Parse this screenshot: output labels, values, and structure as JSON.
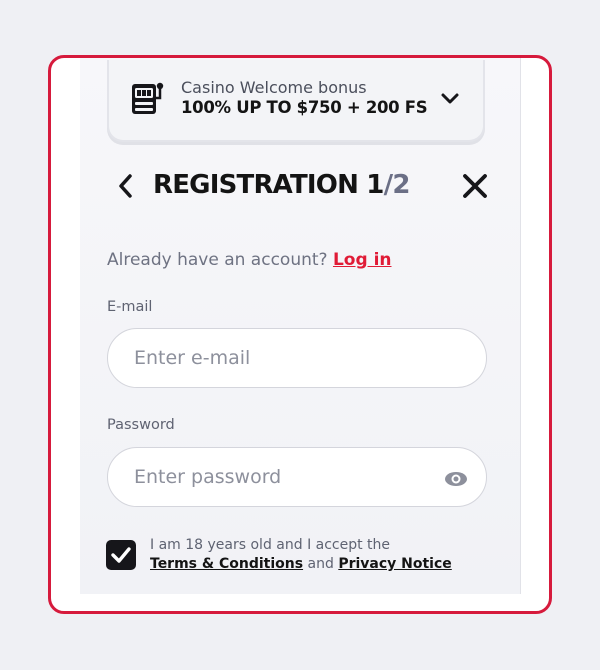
{
  "bonus": {
    "label": "Casino Welcome bonus",
    "title": "100% UP TO $750 + 200 FS",
    "icon": "slot-machine-icon"
  },
  "header": {
    "title": "REGISTRATION 1",
    "step_separator": "/",
    "step_total": "2",
    "back_icon": "chevron-left-icon",
    "close_icon": "close-icon"
  },
  "account": {
    "prompt": "Already have an account? ",
    "login_label": "Log in"
  },
  "email": {
    "label": "E-mail",
    "placeholder": "Enter e-mail"
  },
  "password": {
    "label": "Password",
    "placeholder": "Enter password",
    "toggle_icon": "eye-icon"
  },
  "consent": {
    "checked": true,
    "line1": "I am 18 years old and I accept the",
    "terms_label": "Terms & Conditions",
    "and_text": " and ",
    "privacy_label": "Privacy Notice"
  },
  "colors": {
    "accent": "#e01b36",
    "frame_border": "#d61a3c",
    "background": "#eff0f4"
  }
}
